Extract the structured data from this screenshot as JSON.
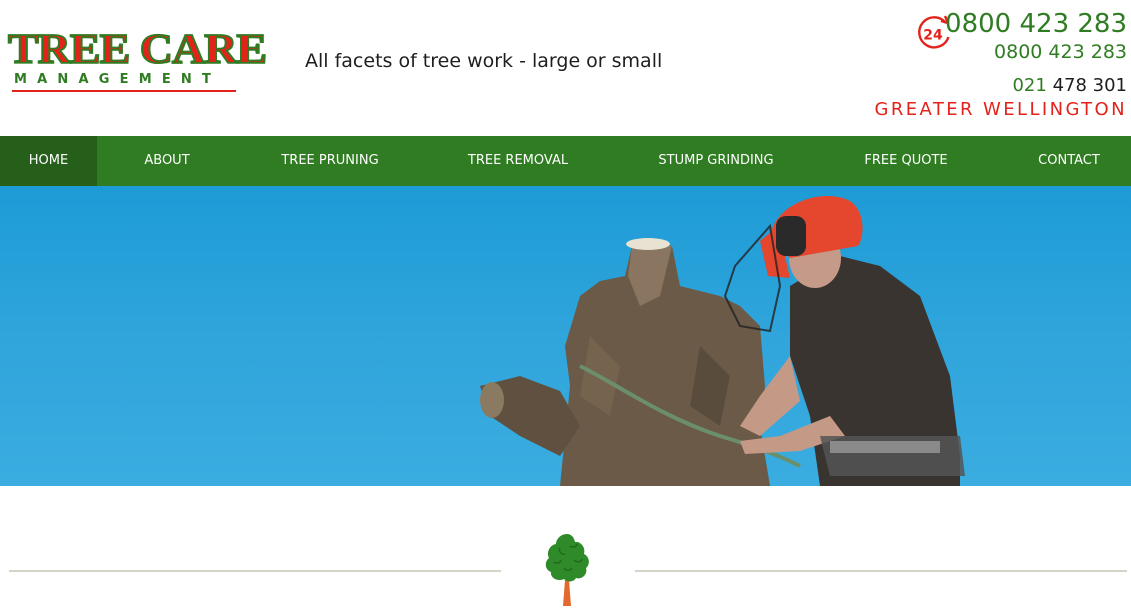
{
  "header": {
    "logo": {
      "main": "TREE CARE",
      "sub": "MANAGEMENT"
    },
    "tagline": "All facets of tree work - large or small",
    "clock_badge": "24",
    "phone_primary": "0800 423 283",
    "phone_secondary": "0800 423 283",
    "mobile_prefix": "021",
    "mobile_number": "478 301",
    "region": "GREATER WELLINGTON"
  },
  "nav": {
    "items": [
      {
        "label": "HOME",
        "active": true
      },
      {
        "label": "ABOUT"
      },
      {
        "label": "TREE PRUNING"
      },
      {
        "label": "TREE REMOVAL"
      },
      {
        "label": "STUMP GRINDING"
      },
      {
        "label": "FREE QUOTE"
      },
      {
        "label": "CONTACT"
      }
    ]
  },
  "colors": {
    "brand_green": "#2f7c22",
    "brand_red": "#e3231b",
    "nav_active": "#255f1a",
    "sky_blue": "#2aa3db"
  },
  "icons": {
    "clock": "clock-24-icon",
    "tree": "tree-icon"
  }
}
